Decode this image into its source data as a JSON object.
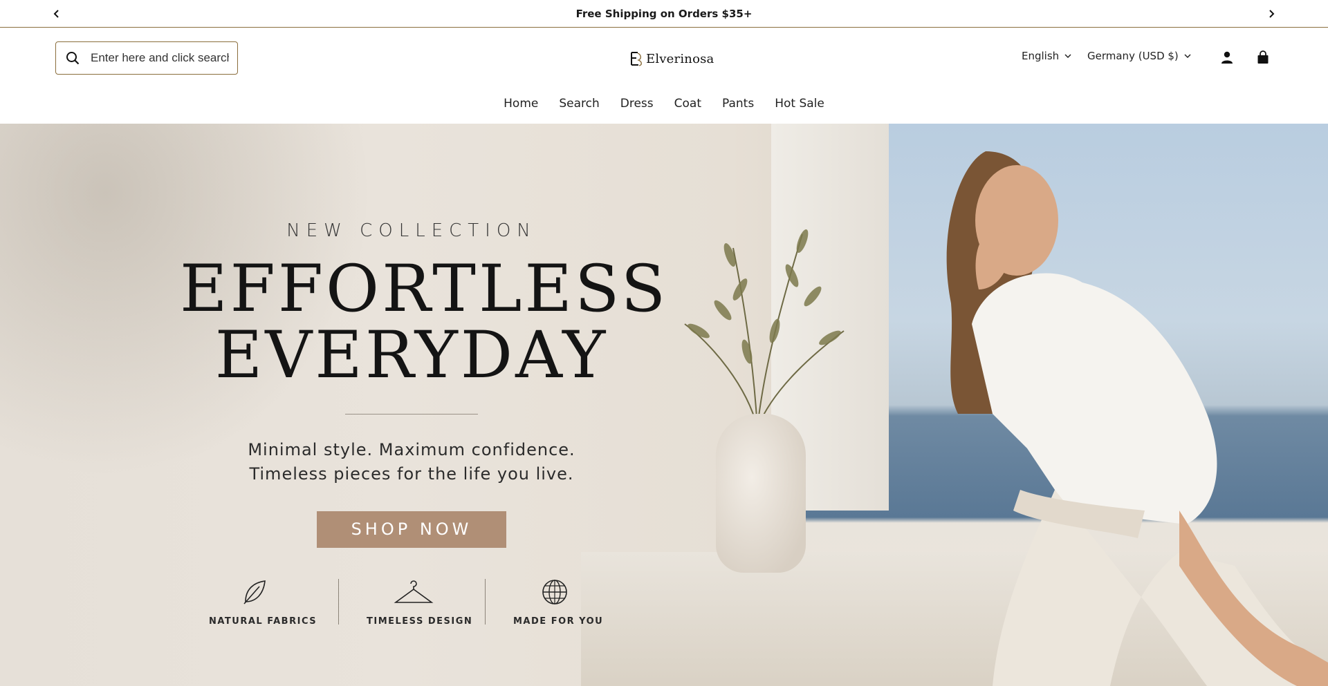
{
  "announcement": {
    "text": "Free Shipping on Orders $35+"
  },
  "header": {
    "search_placeholder": "Enter here and click search",
    "logo_text": "Elverinosa",
    "language": "English",
    "country": "Germany (USD $)"
  },
  "nav": {
    "items": [
      {
        "label": "Home"
      },
      {
        "label": "Search"
      },
      {
        "label": "Dress"
      },
      {
        "label": "Coat"
      },
      {
        "label": "Pants"
      },
      {
        "label": "Hot Sale"
      }
    ]
  },
  "hero": {
    "kicker": "NEW COLLECTION",
    "headline_line1": "EFFORTLESS",
    "headline_line2": "EVERYDAY",
    "sub_line1": "Minimal style. Maximum confidence.",
    "sub_line2": "Timeless pieces for the life you live.",
    "cta_label": "SHOP NOW",
    "cta_color": "#b08f76",
    "features": [
      {
        "label": "NATURAL FABRICS",
        "icon": "leaf-icon"
      },
      {
        "label": "TIMELESS DESIGN",
        "icon": "hanger-icon"
      },
      {
        "label": "MADE FOR YOU",
        "icon": "globe-icon"
      }
    ]
  },
  "colors": {
    "accent_border": "#8a6d3b"
  }
}
